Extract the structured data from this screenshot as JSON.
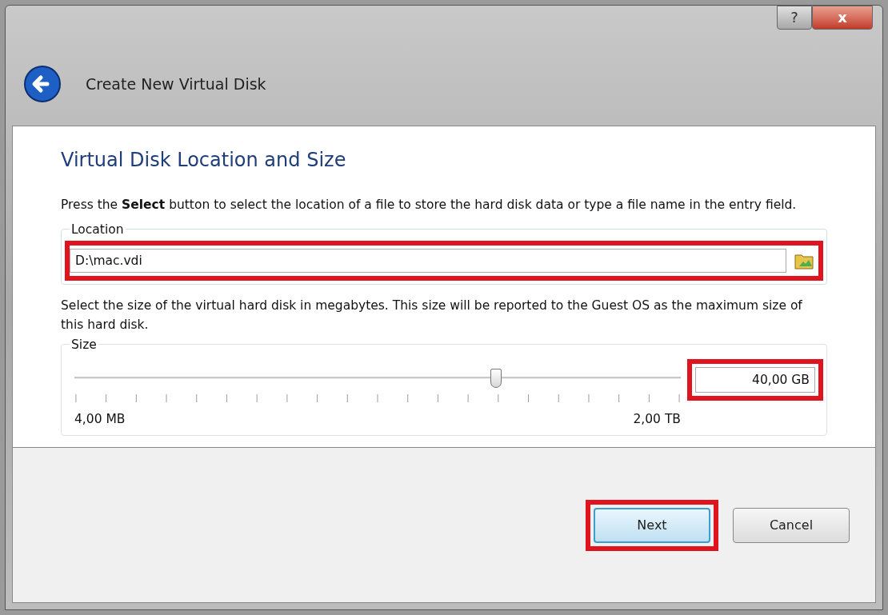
{
  "window": {
    "title": "Create New Virtual Disk",
    "buttons": [
      {
        "kind": "help",
        "label": "?"
      },
      {
        "kind": "close",
        "label": "x"
      }
    ]
  },
  "page": {
    "heading": "Virtual Disk Location and Size",
    "intro": "Press the **Select** button to select the location of a file to store the hard disk data or type a file name in the entry field.",
    "location": {
      "legend": "Location",
      "value": "D:\\mac.vdi",
      "highlighted": true
    },
    "size_text": "Select the size of the virtual hard disk in megabytes. This size will be reported to the Guest OS as the maximum size of this hard disk.",
    "size": {
      "legend": "Size",
      "level": 0.695,
      "value": "40,00 GB",
      "min_label": "4,00 MB",
      "max_label": "2,00 TB",
      "highlighted": true
    }
  },
  "buttons": [
    {
      "label": "Next",
      "default": true,
      "highlighted": true
    },
    {
      "label": "Cancel",
      "default": false,
      "highlighted": false
    }
  ]
}
